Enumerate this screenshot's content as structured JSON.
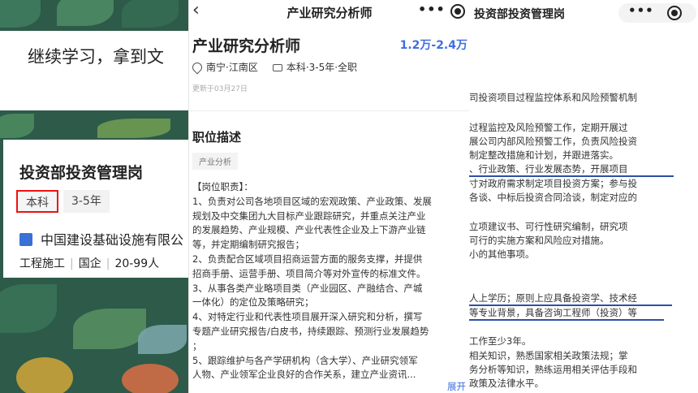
{
  "left": {
    "banner_text": "继续学习，拿到文",
    "card": {
      "title": "投资部投资管理岗",
      "tags": [
        "本科",
        "3-5年"
      ],
      "company": "中国建设基础设施有限公",
      "meta": [
        "工程施工",
        "国企",
        "20-99人"
      ]
    }
  },
  "middle": {
    "nav_title": "产业研究分析师",
    "back_icon": "‹",
    "more_icon": "•••",
    "job_title": "产业研究分析师",
    "salary": "1.2万-2.4万",
    "location": "南宁·江南区",
    "requirements": "本科·3-5年·全职",
    "updated": "更新于03月27日",
    "section_title": "职位描述",
    "category_chip": "产业分析",
    "description": [
      "【岗位职责】：",
      "1、负责对公司各地项目区域的宏观政策、产业政策、发展",
      "规划及中交集团九大目标产业跟踪研究，并重点关注产业",
      "的发展趋势、产业规模、产业代表性企业及上下游产业链",
      "等，并定期编制研究报告；",
      "2、负责配合区域项目招商运营方面的服务支撑，并提供",
      "招商手册、运营手册、项目简介等对外宣传的标准文件。",
      "3、从事各类产业略项目类（产业园区、产融结合、产城",
      "一体化）的定位及策略研究；",
      "4、对特定行业和代表性项目展开深入研究和分析，撰写",
      "专题产业研究报告/白皮书，持续跟踪、预测行业发展趋势",
      "；",
      "5、跟踪维护与各产学研机构（含大学）、产业研究领军",
      "人物、产业领军企业良好的合作关系，建立产业资讯..."
    ],
    "expand_label": "展开"
  },
  "right": {
    "nav_title": "投资部投资管理岗",
    "more_icon": "•••",
    "lines": [
      "司投资项目过程监控体系和风险预警机制",
      "过程监控及风险预警工作，定期开展过",
      "展公司内部风险预警工作，负责风险投资",
      "制定整改措施和计划，并跟进落实。",
      "、行业政策、行业发展态势，开展项目",
      "寸对政府需求制定项目投资方案；参与投",
      "各谈、中标后投资合同洽谈，制定对应的",
      "立项建议书、可行性研究编制，研究项",
      "可行的实施方案和风险应对措施。",
      "小的其他事项。",
      "人上学历；原则上应具备投资学、技术经",
      "等专业背景，具备咨询工程师（投资）等",
      "工作至少3年。",
      "相关知识，熟悉国家相关政策法规；掌",
      "务分析等知识，熟练运用相关评估手段和",
      "政策及法律水平。"
    ]
  },
  "colors": {
    "accent_blue": "#3e6fe0",
    "highlight_red": "#e11111",
    "underline_navy": "#2f4fa6",
    "leaf_green": "#2d5a49"
  }
}
